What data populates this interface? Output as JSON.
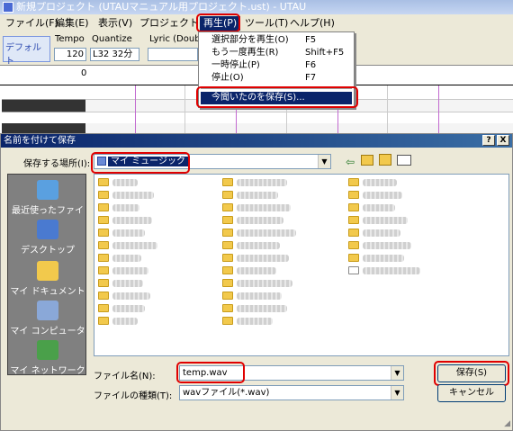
{
  "main_window": {
    "title": "新規プロジェクト (UTAUマニュアル用プロジェクト.ust) - UTAU",
    "menu": [
      "ファイル(F)",
      "編集(E)",
      "表示(V)",
      "プロジェクト(P)",
      "再生(P)",
      "ツール(T)",
      "ヘルプ(H)"
    ],
    "toolbar": {
      "default_tab": "デフォルト",
      "tempo_label": "Tempo",
      "tempo_value": "120",
      "quantize_label": "Quantize",
      "quantize_value": "L32 32分",
      "lyric_label": "Lyric (Doubl"
    },
    "ruler_start": "0"
  },
  "playback_menu": {
    "items": [
      {
        "label": "選択部分を再生(O)",
        "shortcut": "F5"
      },
      {
        "label": "もう一度再生(R)",
        "shortcut": "Shift+F5"
      },
      {
        "label": "一時停止(P)",
        "shortcut": "F6"
      },
      {
        "label": "停止(O)",
        "shortcut": "F7"
      },
      {
        "label": "今聞いたのを保存(S)...",
        "shortcut": ""
      }
    ]
  },
  "save_dialog": {
    "title": "名前を付けて保存",
    "help_button": "?",
    "close_button": "X",
    "location_label": "保存する場所(I):",
    "location_value": "マイ ミュージック",
    "places": [
      "最近使ったファイル",
      "デスクトップ",
      "マイ ドキュメント",
      "マイ コンピュータ",
      "マイ ネットワーク"
    ],
    "filename_label": "ファイル名(N):",
    "filename_value": "temp.wav",
    "filetype_label": "ファイルの種類(T):",
    "filetype_value": "wavファイル(*.wav)",
    "save_button": "保存(S)",
    "cancel_button": "キャンセル"
  },
  "colors": {
    "highlight": "#e00000",
    "selection": "#0a246a",
    "folder": "#f2c94c"
  }
}
